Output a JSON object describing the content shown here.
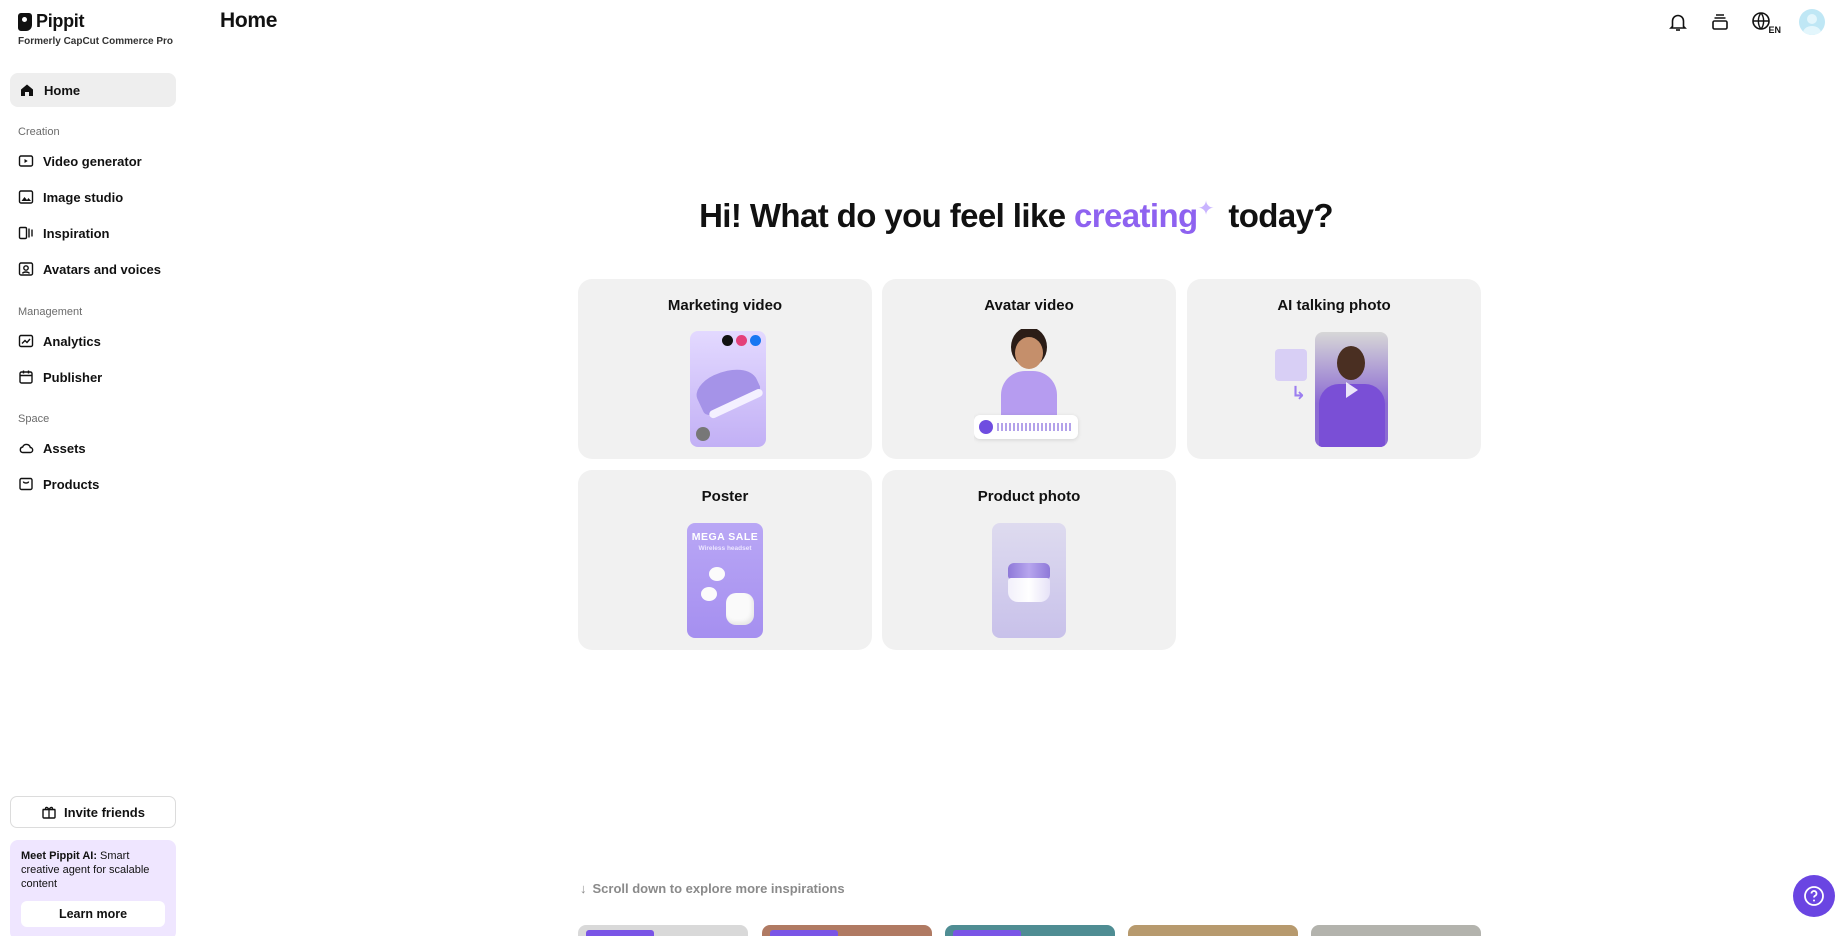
{
  "brand": {
    "name": "Pippit",
    "subtitle": "Formerly CapCut Commerce Pro"
  },
  "header": {
    "title": "Home",
    "language_code": "EN"
  },
  "sidebar": {
    "home": {
      "label": "Home",
      "icon": "home-icon"
    },
    "sections": [
      {
        "title": "Creation",
        "items": [
          {
            "label": "Video generator",
            "icon": "video-plus-icon"
          },
          {
            "label": "Image studio",
            "icon": "image-edit-icon"
          },
          {
            "label": "Inspiration",
            "icon": "inspiration-icon"
          },
          {
            "label": "Avatars and voices",
            "icon": "avatar-voice-icon"
          }
        ]
      },
      {
        "title": "Management",
        "items": [
          {
            "label": "Analytics",
            "icon": "analytics-icon"
          },
          {
            "label": "Publisher",
            "icon": "calendar-icon"
          }
        ]
      },
      {
        "title": "Space",
        "items": [
          {
            "label": "Assets",
            "icon": "cloud-icon"
          },
          {
            "label": "Products",
            "icon": "box-icon"
          }
        ]
      }
    ],
    "invite_label": "Invite friends",
    "promo": {
      "bold": "Meet Pippit AI:",
      "text": " Smart creative agent for scalable content",
      "button": "Learn more"
    }
  },
  "hero": {
    "prefix": "Hi! What do you feel like ",
    "accent": "creating",
    "suffix": " today?"
  },
  "cards": [
    {
      "title": "Marketing video"
    },
    {
      "title": "Avatar video"
    },
    {
      "title": "AI talking photo"
    },
    {
      "title": "Poster",
      "thumb_text": "MEGA SALE",
      "thumb_subtext": "Wireless headset"
    },
    {
      "title": "Product photo"
    }
  ],
  "scroll_hint": "Scroll down to explore more inspirations",
  "colors": {
    "accent": "#8e62f0",
    "help_button": "#6a45e2",
    "promo_bg": "#efe6ff"
  }
}
